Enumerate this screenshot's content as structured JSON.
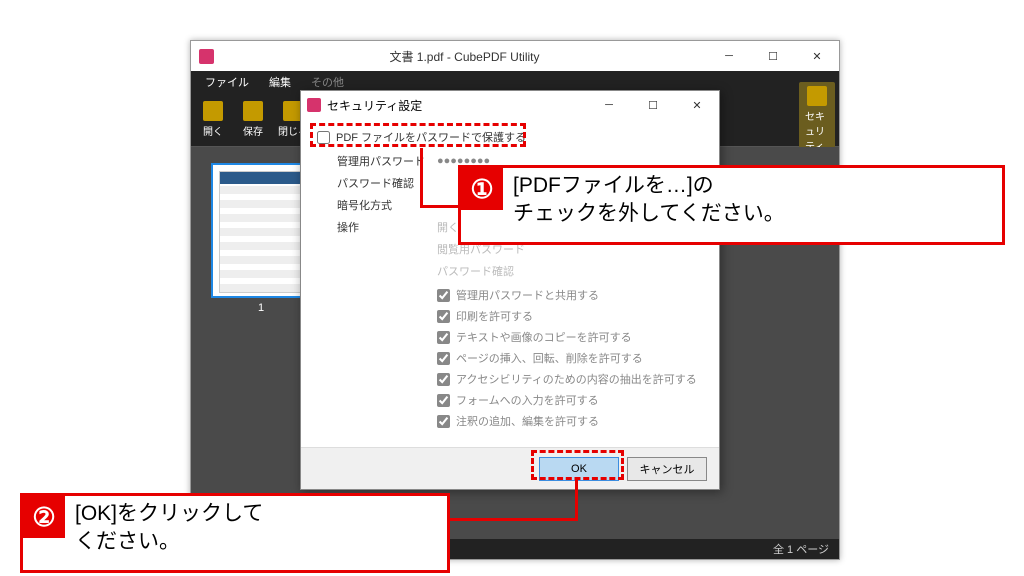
{
  "app": {
    "title": "文書 1.pdf - CubePDF Utility",
    "menus": {
      "file": "ファイル",
      "edit": "編集",
      "other": "その他"
    },
    "toolbar": {
      "open": "開く",
      "save": "保存",
      "close": "閉じる",
      "security": "セキュリティ"
    },
    "thumb_num": "1",
    "status": "全 1 ページ"
  },
  "dialog": {
    "title": "セキュリティ設定",
    "protect_checkbox": "PDF ファイルをパスワードで保護する",
    "labels": {
      "admin_pw": "管理用パスワード",
      "pw_confirm": "パスワード確認",
      "encryption": "暗号化方式",
      "operation": "操作"
    },
    "masked": "●●●●●●●●",
    "op_open_pw": "開く際にパスワードを要求する",
    "op_view_pw": "閲覧用パスワード",
    "op_pw_confirm": "パスワード確認",
    "perms": [
      "管理用パスワードと共用する",
      "印刷を許可する",
      "テキストや画像のコピーを許可する",
      "ページの挿入、回転、削除を許可する",
      "アクセシビリティのための内容の抽出を許可する",
      "フォームへの入力を許可する",
      "注釈の追加、編集を許可する"
    ],
    "ok": "OK",
    "cancel": "キャンセル"
  },
  "annotations": {
    "step1": "[PDFファイルを…]の\nチェックを外してください。",
    "step2": "[OK]をクリックして\nください。",
    "num1": "①",
    "num2": "②"
  }
}
